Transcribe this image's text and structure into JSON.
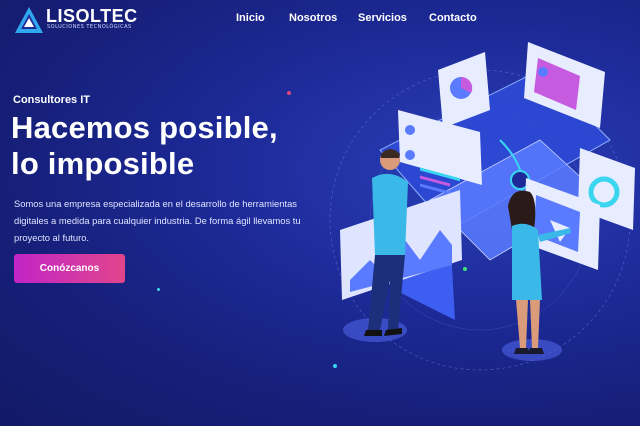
{
  "brand": {
    "name": "LISOLTEC",
    "tagline": "SOLUCIONES TECNOLÓGICAS"
  },
  "nav": {
    "items": [
      {
        "label": "Inicio"
      },
      {
        "label": "Nosotros"
      },
      {
        "label": "Servicios"
      },
      {
        "label": "Contacto"
      }
    ]
  },
  "hero": {
    "kicker": "Consultores IT",
    "headline_line1": "Hacemos posible,",
    "headline_line2": "lo imposible",
    "description": "Somos una empresa especializada en el desarrollo de herramientas digitales a medida para cualquier industria. De forma ágil llevamos tu proyecto al futuro.",
    "cta_label": "Conózcanos"
  },
  "colors": {
    "background": "#1d2a98",
    "cta_start": "#c125c6",
    "cta_end": "#e0458b",
    "accent_cyan": "#3ad6f0"
  },
  "illustration": {
    "icon": "isometric-dashboard-people-illustration"
  }
}
